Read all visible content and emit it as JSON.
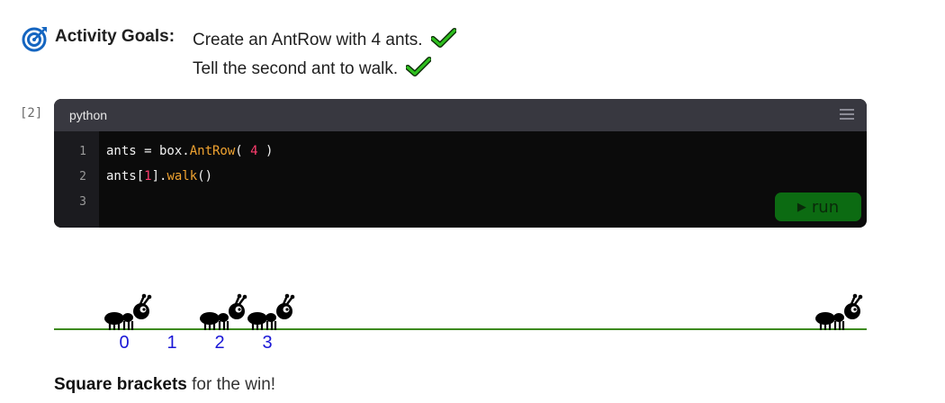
{
  "goals": {
    "title": "Activity Goals:",
    "items": [
      {
        "text": "Create an AntRow with 4 ants.",
        "status": "completed"
      },
      {
        "text": "Tell the second ant to walk.",
        "status": "completed"
      }
    ],
    "check_color": "#2fbf1f",
    "icon_color": "#1565c0"
  },
  "cell": {
    "prompt": "[2]",
    "language": "python",
    "line_numbers": [
      "1",
      "2",
      "3"
    ],
    "lines": [
      {
        "a": "ants = box.",
        "fn": "AntRow",
        "b": "( ",
        "num": "4",
        "c": " )"
      },
      {
        "a": "ants[",
        "num": "1",
        "b": "].",
        "fn": "walk",
        "c": "()"
      },
      {
        "a": "",
        "num": "",
        "b": "",
        "fn": "",
        "c": ""
      }
    ],
    "run_label": "run",
    "run_color": "#0c6b12"
  },
  "ants": {
    "labels": [
      "0",
      "1",
      "2",
      "3"
    ],
    "ground_color": "#3d8a1f",
    "label_color": "#1a17d6"
  },
  "footer": {
    "bold": "Square brackets",
    "rest": " for the win!"
  }
}
